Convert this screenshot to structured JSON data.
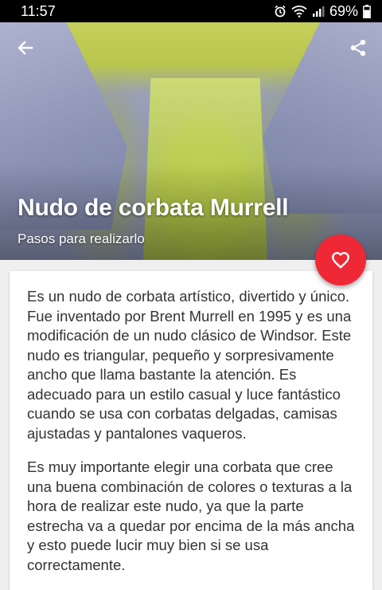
{
  "status_bar": {
    "time": "11:57",
    "battery": "69%",
    "icons": [
      "alarm-icon",
      "wifi-icon",
      "signal-icon",
      "battery-icon"
    ]
  },
  "toolbar": {
    "back_icon": "arrow-left-icon",
    "share_icon": "share-icon"
  },
  "hero": {
    "title": "Nudo de corbata Murrell",
    "subtitle": "Pasos para realizarlo"
  },
  "fab": {
    "icon": "heart-outline-icon",
    "color": "#ef2836"
  },
  "content": {
    "paragraphs": [
      "Es un nudo de corbata artístico, divertido y único. Fue inventado por Brent Murrell en 1995 y es una modificación de un nudo clásico de Windsor. Este nudo es triangular, pequeño y sorpresivamente ancho que llama bastante la atención.  Es adecuado para un estilo casual y luce fantástico cuando se usa con corbatas delgadas, camisas ajustadas y pantalones vaqueros.",
      "Es muy importante elegir una corbata que cree una buena combinación de colores o texturas a la hora de realizar este nudo, ya que la parte estrecha va a quedar por encima de la más ancha y esto puede lucir muy bien si se usa correctamente."
    ]
  }
}
